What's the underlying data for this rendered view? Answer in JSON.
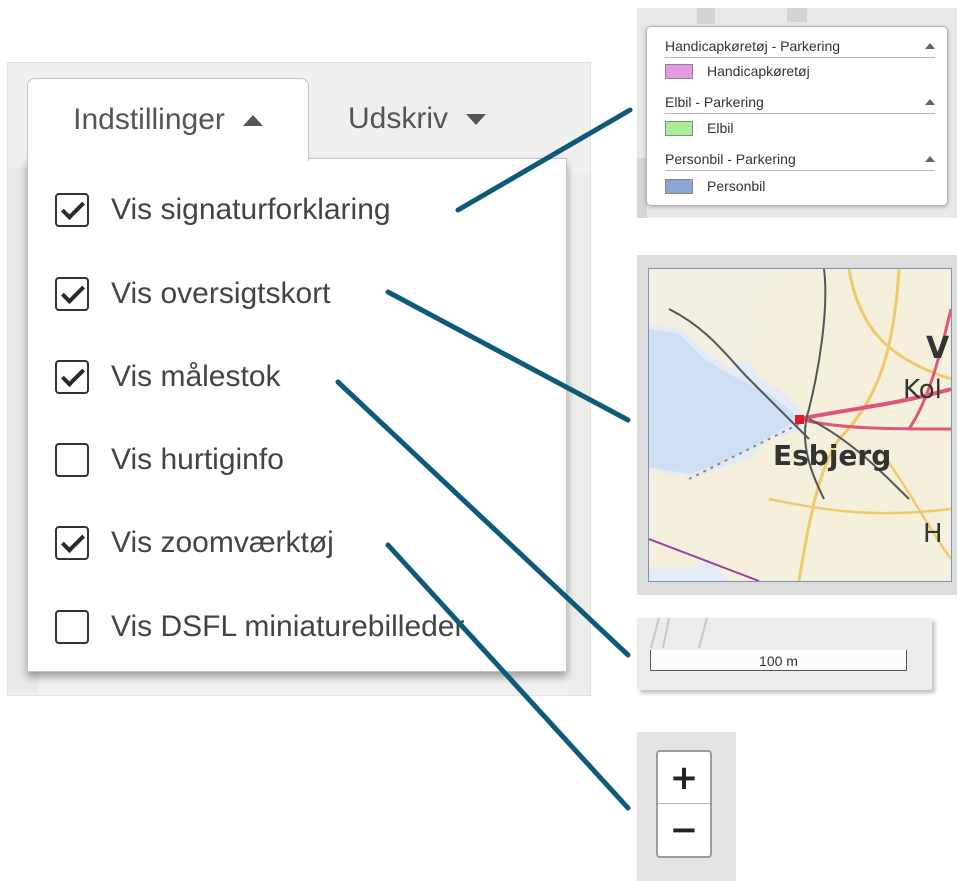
{
  "tabs": {
    "settings": "Indstillinger",
    "print": "Udskriv"
  },
  "options": [
    {
      "label": "Vis signaturforklaring",
      "checked": true
    },
    {
      "label": "Vis oversigtskort",
      "checked": true
    },
    {
      "label": "Vis målestok",
      "checked": true
    },
    {
      "label": "Vis hurtiginfo",
      "checked": false
    },
    {
      "label": "Vis zoomværktøj",
      "checked": true
    },
    {
      "label": "Vis DSFL miniaturebilleder",
      "checked": false
    }
  ],
  "legend": {
    "groups": [
      {
        "title": "Handicapkøretøj - Parkering",
        "item": "Handicapkøretøj",
        "color": "#e39be8"
      },
      {
        "title": "Elbil - Parkering",
        "item": "Elbil",
        "color": "#a9ee96"
      },
      {
        "title": "Personbil - Parkering",
        "item": "Personbil",
        "color": "#8aa6d4"
      }
    ]
  },
  "overview_map": {
    "city": "Esbjerg",
    "partial_labels": [
      "V",
      "Kol",
      "H"
    ]
  },
  "scale": {
    "label": "100 m"
  },
  "zoom": {
    "in": "+",
    "out": "−"
  },
  "colors": {
    "callout_line": "#0e5a7a"
  }
}
